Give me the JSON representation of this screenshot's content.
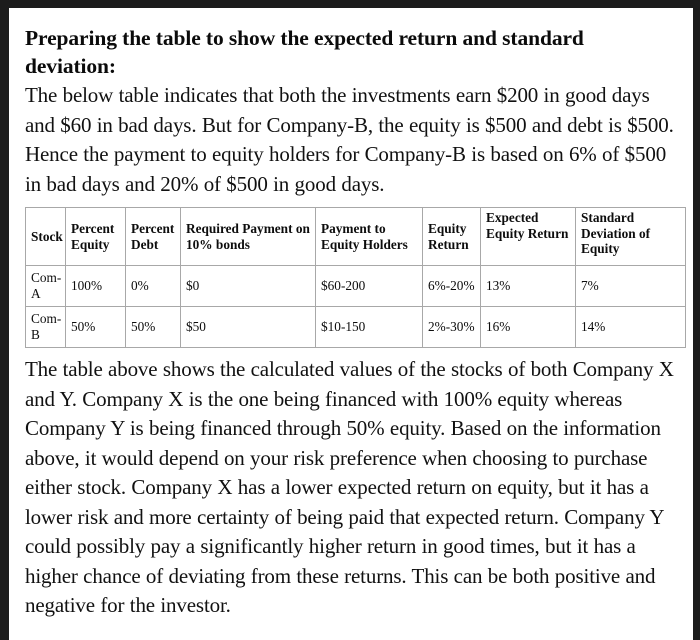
{
  "document": {
    "heading": "Preparing the table to show the expected return and standard deviation:",
    "intro_paragraph": "The below table indicates that both the investments earn $200 in good days and $60 in bad days. But for Company-B, the equity is $500 and debt is $500. Hence the payment to equity holders for Company-B is based on 6% of $500 in bad days and 20% of $500 in good days.",
    "outro_paragraph": "The table above shows the calculated values of the stocks of both Company X and Y. Company X is the one being financed with 100% equity whereas Company Y is being financed through 50% equity. Based on the information above, it would depend on your risk preference when choosing to purchase either stock. Company X has a lower expected return on equity, but it has a lower risk and more certainty of being paid that expected return. Company Y could possibly pay a significantly higher return in good times, but it has a higher chance of deviating from these returns. This can be both positive and negative for the investor."
  },
  "table": {
    "headers": [
      "Stock",
      "Percent Equity",
      "Percent Debt",
      "Required Payment on 10% bonds",
      "Payment to Equity Holders",
      "Equity Return",
      "Expected Equity Return",
      "Standard Deviation of Equity"
    ],
    "rows": [
      {
        "stock": "Com-A",
        "percent_equity": "100%",
        "percent_debt": "0%",
        "required_payment": "$0",
        "payment_to_equity_holders": "$60-200",
        "equity_return": "6%-20%",
        "expected_equity_return": "13%",
        "standard_deviation_of_equity": "7%"
      },
      {
        "stock": "Com-B",
        "percent_equity": "50%",
        "percent_debt": "50%",
        "required_payment": "$50",
        "payment_to_equity_holders": "$10-150",
        "equity_return": "2%-30%",
        "expected_equity_return": "16%",
        "standard_deviation_of_equity": "14%"
      }
    ]
  },
  "colors": {
    "page_background": "#ffffff",
    "frame_border": "#1c1c1c",
    "text": "#111111",
    "table_outer_border": "#6d6d6d",
    "table_inner_border": "#a8a8a8"
  }
}
